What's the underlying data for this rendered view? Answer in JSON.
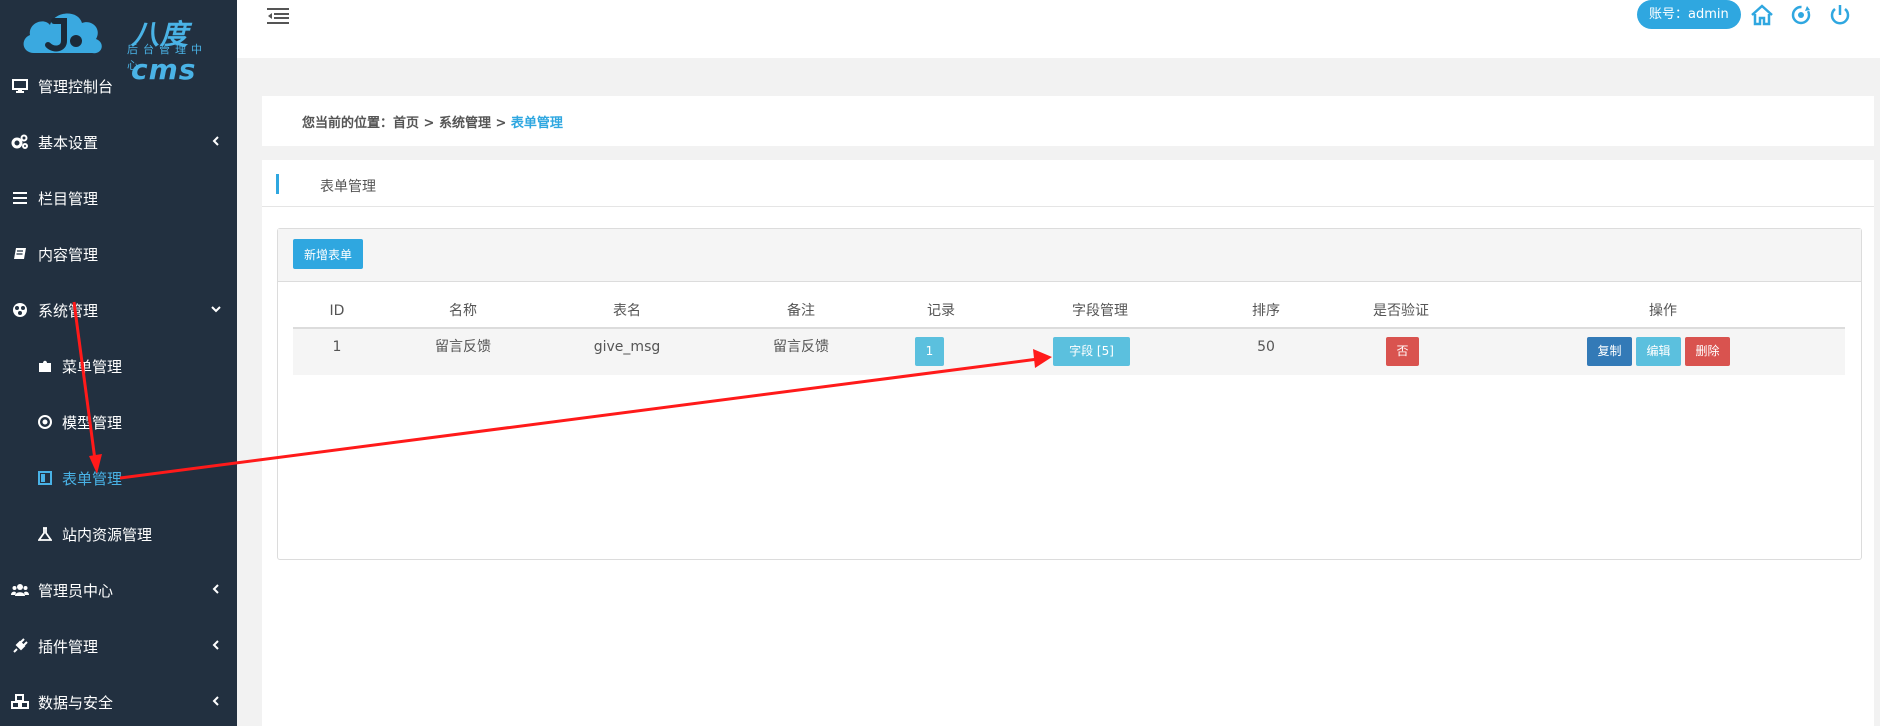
{
  "logo": {
    "name": "八度cms",
    "subtitle": "后台管理中心"
  },
  "sidebar": {
    "items": [
      {
        "label": "管理控制台",
        "icon": "monitor-icon",
        "has_chevron": false
      },
      {
        "label": "基本设置",
        "icon": "cogs-icon",
        "has_chevron": true
      },
      {
        "label": "栏目管理",
        "icon": "bars-icon",
        "has_chevron": false
      },
      {
        "label": "内容管理",
        "icon": "book-icon",
        "has_chevron": false
      },
      {
        "label": "系统管理",
        "icon": "globe-icon",
        "has_chevron": true,
        "expanded": true
      },
      {
        "label": "菜单管理",
        "icon": "puzzle-icon",
        "sub": true
      },
      {
        "label": "模型管理",
        "icon": "target-icon",
        "sub": true
      },
      {
        "label": "表单管理",
        "icon": "window-icon",
        "sub": true,
        "active": true
      },
      {
        "label": "站内资源管理",
        "icon": "flask-icon",
        "sub": true
      },
      {
        "label": "管理员中心",
        "icon": "users-icon",
        "has_chevron": true
      },
      {
        "label": "插件管理",
        "icon": "plug-icon",
        "has_chevron": true
      },
      {
        "label": "数据与安全",
        "icon": "cubes-icon",
        "has_chevron": true
      }
    ]
  },
  "topbar": {
    "account": "账号：admin",
    "icons": [
      "home-icon",
      "refresh-icon",
      "power-icon"
    ]
  },
  "breadcrumb": {
    "prefix": "您当前的位置：首页 > 系统管理 > ",
    "current": "表单管理"
  },
  "panel": {
    "title": "表单管理"
  },
  "toolbar": {
    "new_label": "新增表单"
  },
  "table": {
    "headers": [
      "ID",
      "名称",
      "表名",
      "备注",
      "记录",
      "字段管理",
      "排序",
      "是否验证",
      "操作"
    ],
    "rows": [
      {
        "id": "1",
        "name": "留言反馈",
        "table_name": "give_msg",
        "remark": "留言反馈",
        "records": "1",
        "fields": "字段 [5]",
        "sort": "50",
        "verify": "否",
        "actions": [
          "复制",
          "编辑",
          "删除"
        ]
      }
    ]
  },
  "colors": {
    "sidebar_bg": "#223040",
    "accent": "#2fa7e0",
    "info": "#5bc0de",
    "danger": "#d9534f",
    "primary": "#337ab7",
    "annotation": "#ff1a1a"
  }
}
